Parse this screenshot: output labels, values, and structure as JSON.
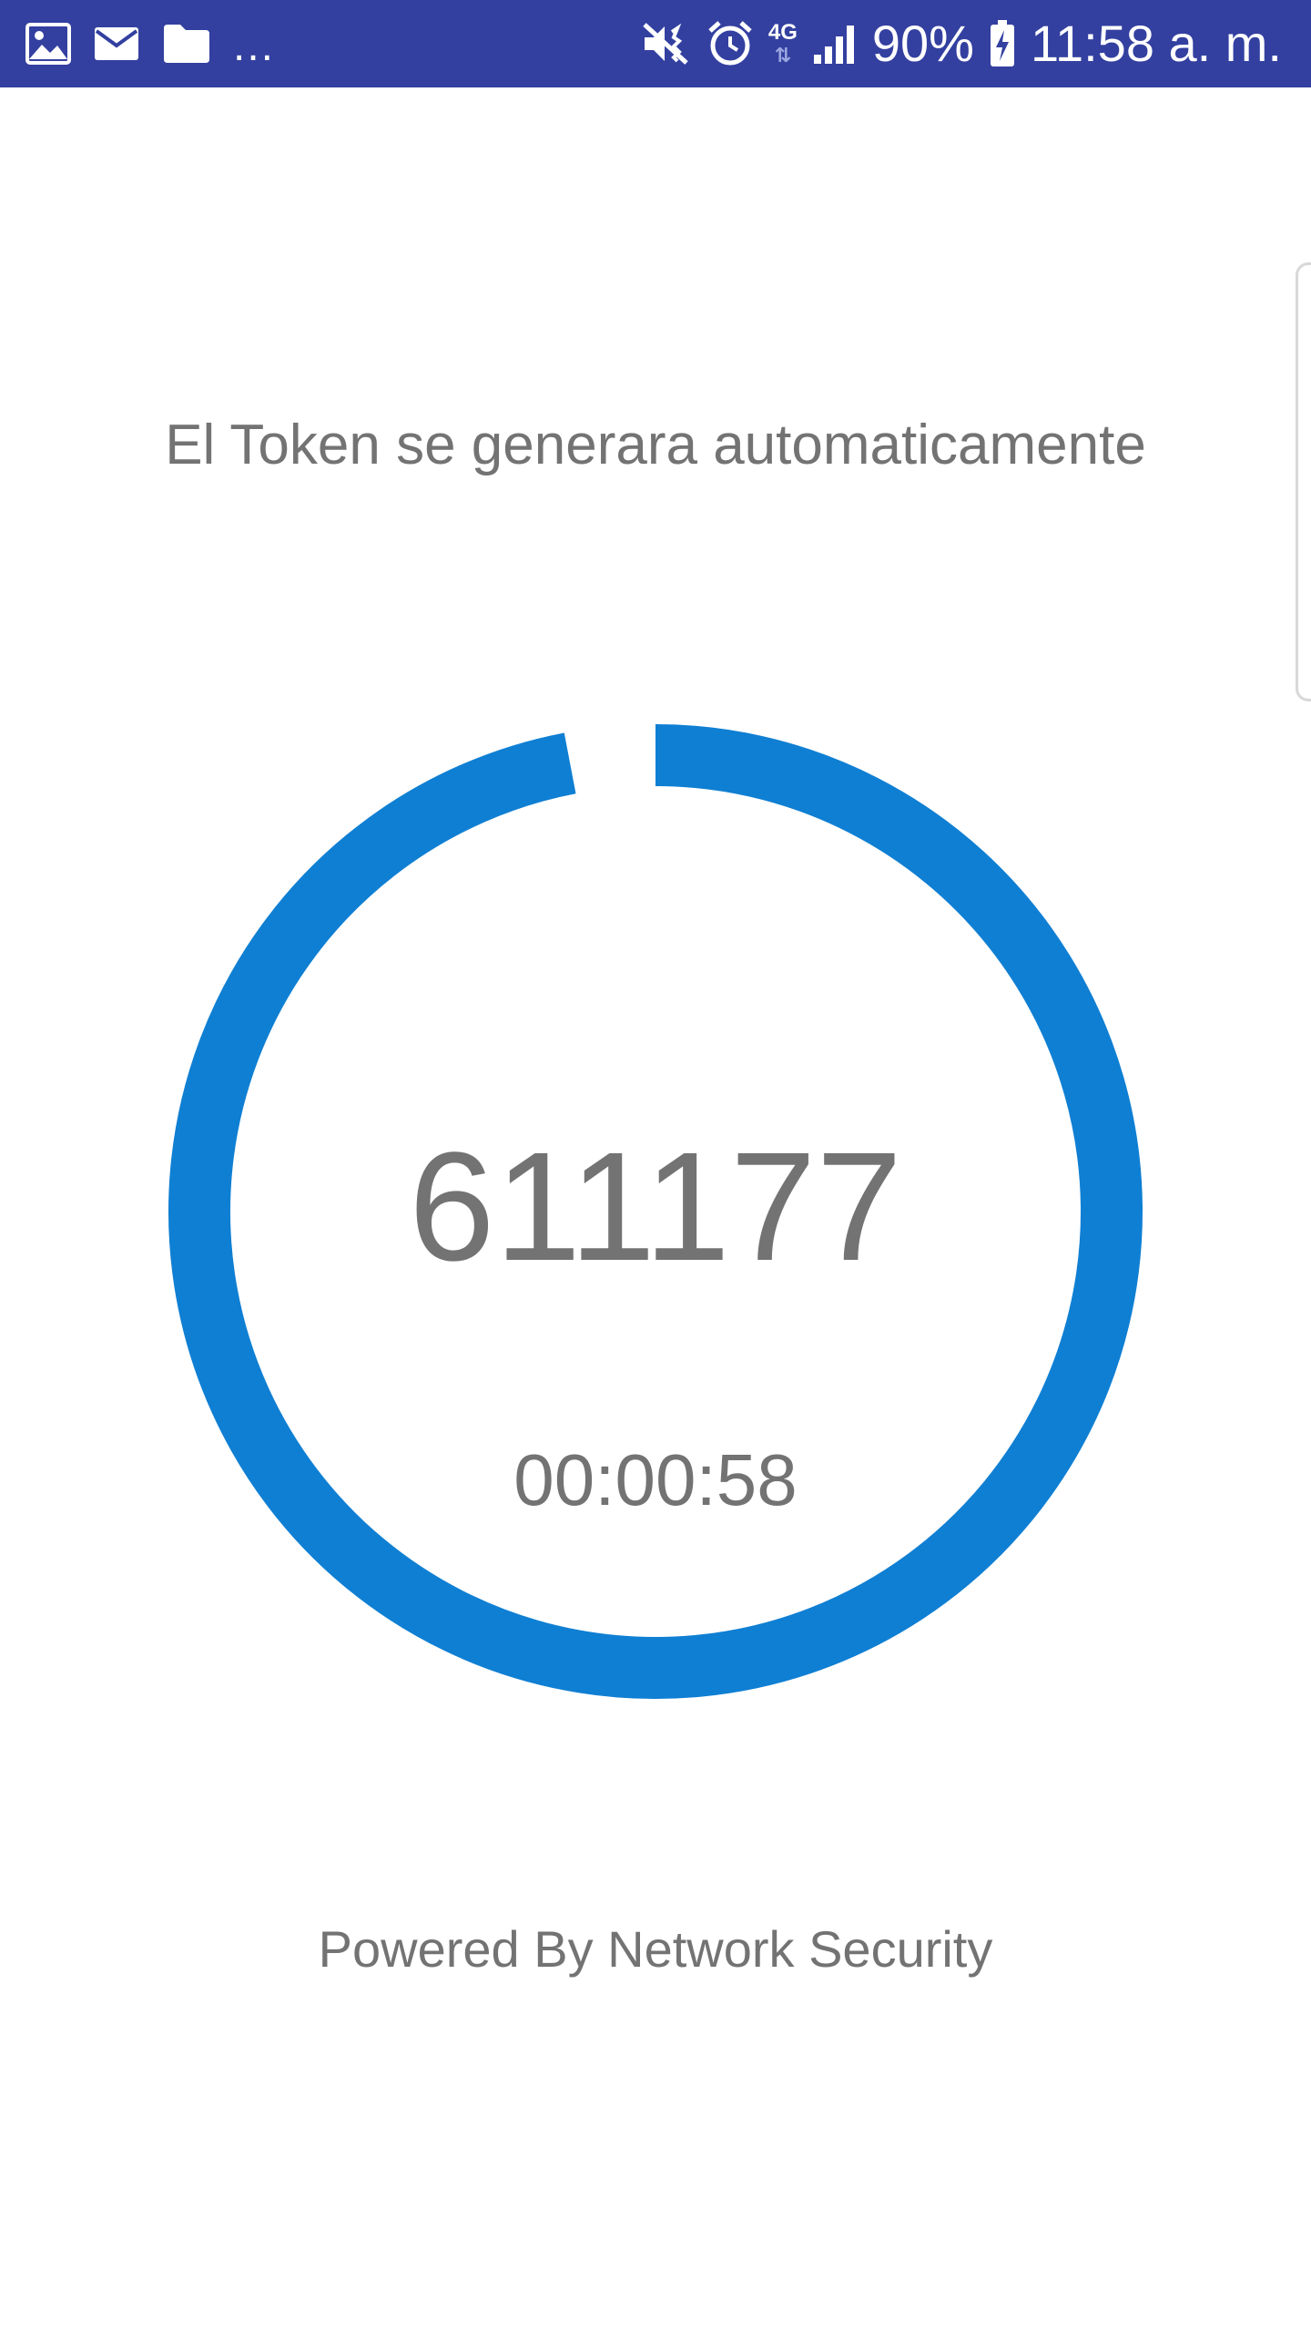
{
  "status_bar": {
    "background": "#3340a0",
    "left_icons": [
      "gallery-icon",
      "email-icon",
      "folder-icon"
    ],
    "more_indicator": "...",
    "right_icons": [
      "mute-vibrate-icon",
      "alarm-icon",
      "network-4g-icon",
      "signal-icon",
      "battery-charging-icon"
    ],
    "network_type": "4G",
    "battery": "90%",
    "time": "11:58 a. m."
  },
  "main": {
    "headline": "El Token se generara automaticamente",
    "token": "611177",
    "timer": "00:00:58",
    "countdown_fraction_remaining": 0.97,
    "ring_color": "#0f7fd3"
  },
  "footer": {
    "text": "Powered By Network Security"
  }
}
